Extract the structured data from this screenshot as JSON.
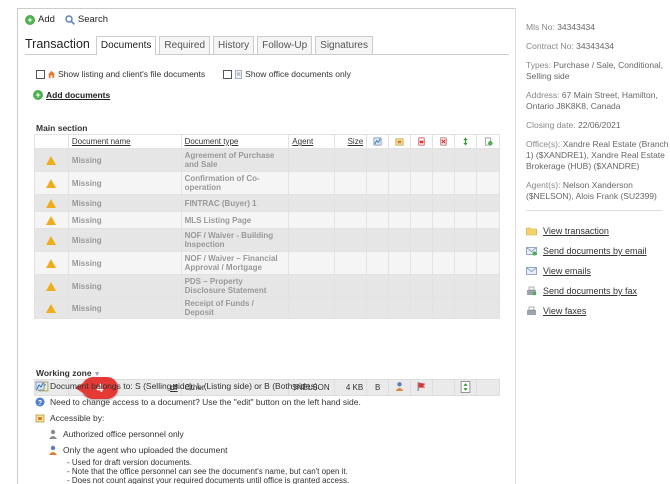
{
  "toolbar": {
    "add_label": "Add",
    "search_label": "Search"
  },
  "tabs": {
    "title": "Transaction",
    "items": [
      "Documents",
      "Required",
      "History",
      "Follow-Up",
      "Signatures"
    ]
  },
  "filters": {
    "show_listing": "Show listing and client's file documents",
    "show_office": "Show office documents only"
  },
  "add_documents": "Add documents",
  "main_section": {
    "title": "Main section",
    "columns": {
      "name": "Document name",
      "type": "Document type",
      "agent": "Agent",
      "size": "Size"
    },
    "rows": [
      {
        "name": "Missing",
        "type": "Agreement of Purchase and Sale"
      },
      {
        "name": "Missing",
        "type": "Confirmation of Co-operation"
      },
      {
        "name": "Missing",
        "type": "FINTRAC (Buyer) 1"
      },
      {
        "name": "Missing",
        "type": "MLS Listing Page"
      },
      {
        "name": "Missing",
        "type": "NOF / Waiver - Building Inspection"
      },
      {
        "name": "Missing",
        "type": "NOF / Waiver – Financial Approval / Mortgage"
      },
      {
        "name": "Missing",
        "type": "PDS – Property Disclosure Statement"
      },
      {
        "name": "Missing",
        "type": "Receipt of Funds / Deposit"
      }
    ]
  },
  "working_zone": {
    "title": "Working zone",
    "row": {
      "name_suffix": "df",
      "type": "Other",
      "agent": "$NELSON",
      "size": "4 KB",
      "side": "B"
    },
    "badge": "4"
  },
  "legend": {
    "side": "Document belongs to: S (Selling side), L (Listing side) or B (Both sides).",
    "access_change": "Need to change access to a document? Use the \"edit\" button on the left hand side.",
    "accessible_by": "Accessible by:",
    "authorized": "Authorized office personnel only",
    "uploader": "Only the agent who uploaded the document",
    "notes": [
      "- Used for draft version documents.",
      "- Note that the office personnel can see the document's name, but can't open it.",
      "- Does not count against your required documents until office is granted access."
    ]
  },
  "sidebar": {
    "mls_label": "Mls No:",
    "mls_value": "34343434",
    "contract_label": "Contract No:",
    "contract_value": "34343434",
    "types_label": "Types:",
    "types_value": "Purchase / Sale, Conditional, Selling side",
    "address_label": "Address:",
    "address_value": "67 Main Street, Hamilton, Ontario J8K8K8, Canada",
    "closing_label": "Closing date:",
    "closing_value": "22/06/2021",
    "offices_label": "Office(s):",
    "offices_value": "Xandre Real Estate (Branch 1) ($XANDRE1), Xandre Real Estate Brokerage (HUB) ($XANDRE)",
    "agents_label": "Agent(s):",
    "agents_value": "Nelson Xanderson ($NELSON), Alois Frank (SU2399)",
    "actions": [
      "View transaction",
      "Send documents by email",
      "View emails",
      "Send documents by fax",
      "View faxes"
    ]
  },
  "colors": {
    "warning": "#f0ad1a",
    "badge": "#e53935",
    "add_green": "#4caf50"
  }
}
